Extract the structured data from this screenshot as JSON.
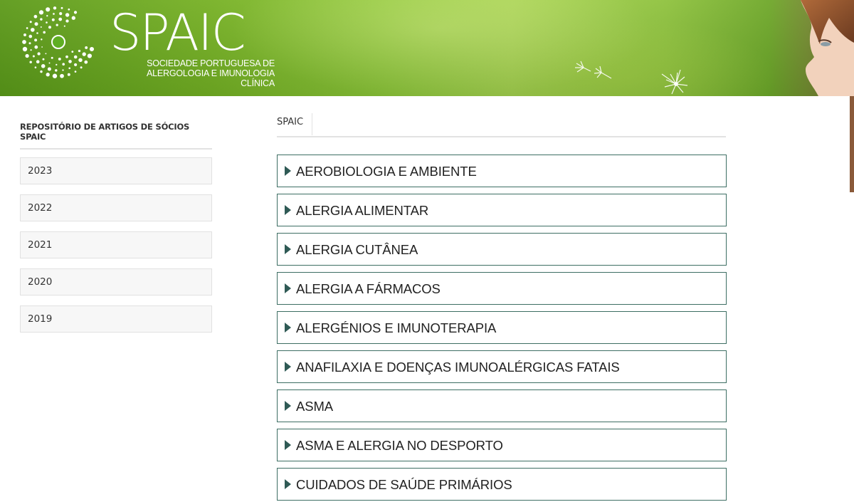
{
  "header": {
    "logo_word": "SPAIC",
    "logo_sub_line1": "SOCIEDADE PORTUGUESA DE",
    "logo_sub_line2": "ALERGOLOGIA E IMUNOLOGIA CLÍNICA"
  },
  "sidebar": {
    "title": "REPOSITÓRIO DE ARTIGOS DE SÓCIOS SPAIC",
    "years": [
      "2023",
      "2022",
      "2021",
      "2020",
      "2019"
    ]
  },
  "main": {
    "breadcrumb": "SPAIC",
    "topics": [
      "AEROBIOLOGIA E AMBIENTE",
      "ALERGIA ALIMENTAR",
      "ALERGIA CUTÂNEA",
      "ALERGIA A FÁRMACOS",
      "ALERGÉNIOS E IMUNOTERAPIA",
      "ANAFILAXIA E DOENÇAS IMUNOALÉRGICAS FATAIS",
      "ASMA",
      "ASMA E ALERGIA NO DESPORTO",
      "CUIDADOS DE SAÚDE PRIMÁRIOS"
    ]
  },
  "icons": {
    "topic_arrow": "caret-right-icon",
    "logo_mark": "dotted-circle-logo-icon"
  },
  "colors": {
    "banner_green": "#8fc63a",
    "topic_border": "#3d6e63",
    "topic_arrow": "#2f5a55"
  }
}
